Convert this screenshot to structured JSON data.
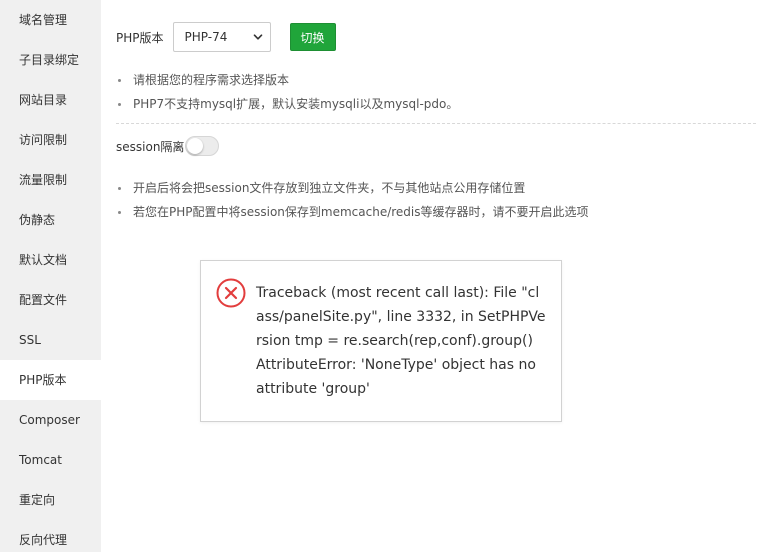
{
  "sidebar": {
    "items": [
      {
        "label": "域名管理"
      },
      {
        "label": "子目录绑定"
      },
      {
        "label": "网站目录"
      },
      {
        "label": "访问限制"
      },
      {
        "label": "流量限制"
      },
      {
        "label": "伪静态"
      },
      {
        "label": "默认文档"
      },
      {
        "label": "配置文件"
      },
      {
        "label": "SSL"
      },
      {
        "label": "PHP版本",
        "active": true
      },
      {
        "label": "Composer"
      },
      {
        "label": "Tomcat"
      },
      {
        "label": "重定向"
      },
      {
        "label": "反向代理"
      }
    ]
  },
  "php": {
    "label": "PHP版本",
    "selected_version": "PHP-74",
    "switch_label": "切换",
    "tips": [
      "请根据您的程序需求选择版本",
      "PHP7不支持mysql扩展，默认安装mysqli以及mysql-pdo。"
    ]
  },
  "session": {
    "label": "session隔离",
    "enabled": false,
    "tips": [
      "开启后将会把session文件存放到独立文件夹，不与其他站点公用存储位置",
      "若您在PHP配置中将session保存到memcache/redis等缓存器时，请不要开启此选项"
    ]
  },
  "error": {
    "icon": "error-circle-icon",
    "color": "#e23d3d",
    "message": "Traceback (most recent call last): File \"class/panelSite.py\", line 3332, in SetPHPVersion tmp = re.search(rep,conf).group() AttributeError: 'NoneType' object has no attribute 'group'"
  },
  "colors": {
    "accent": "#20a53a",
    "sidebar_bg": "#f0f0f0"
  }
}
